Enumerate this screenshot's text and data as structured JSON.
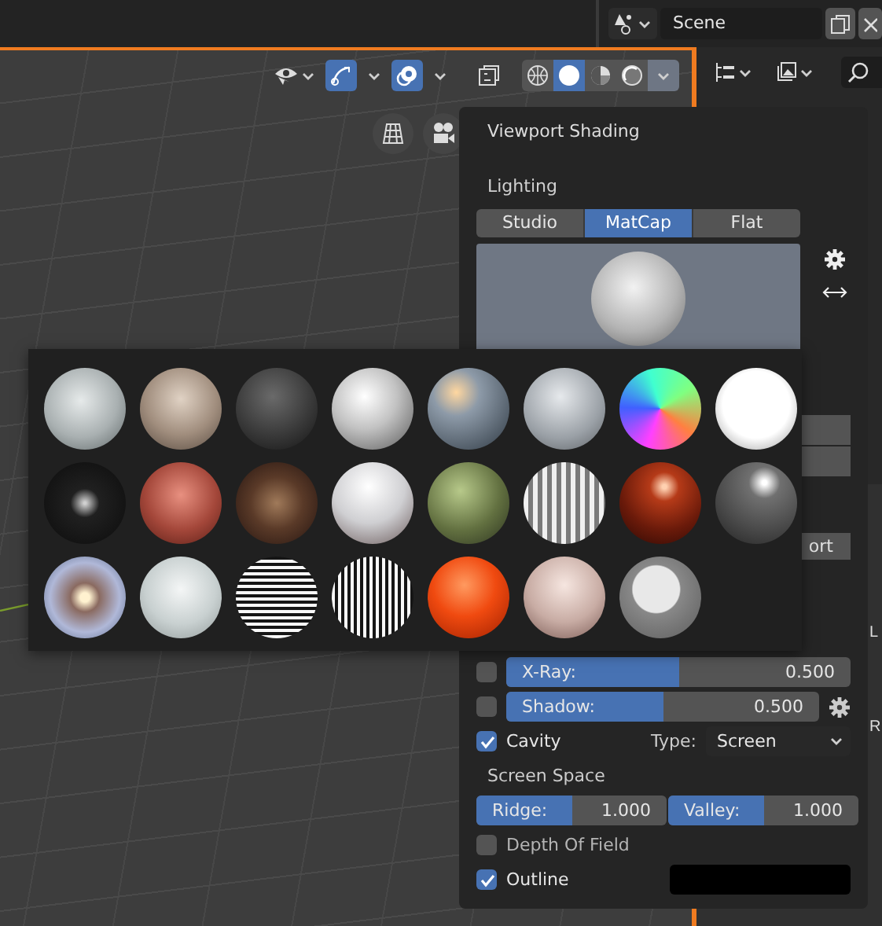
{
  "top_bar": {
    "scene": "Scene"
  },
  "viewport_header": {
    "gizmo_toggle": {
      "on": true
    },
    "overlay_toggle": {
      "on": true
    },
    "xray_toggle": {
      "on": false
    },
    "shading_modes": [
      {
        "kind": "wireframe",
        "selected": false
      },
      {
        "kind": "solid",
        "selected": true
      },
      {
        "kind": "material",
        "selected": false
      },
      {
        "kind": "rendered",
        "selected": false
      }
    ]
  },
  "properties": {
    "fields": [
      "L",
      "R"
    ]
  },
  "shading_panel": {
    "title": "Viewport Shading",
    "lighting_label": "Lighting",
    "lighting_tabs": [
      {
        "label": "Studio",
        "selected": false
      },
      {
        "label": "MatCap",
        "selected": true
      },
      {
        "label": "Flat",
        "selected": false
      }
    ],
    "background_fragment": "ort",
    "options": [
      {
        "kind": "slider",
        "label": "X-Ray:",
        "value": "0.500",
        "level": 0.5,
        "checked": false
      },
      {
        "kind": "slider_settings",
        "label": "Shadow:",
        "value": "0.500",
        "level": 0.5,
        "checked": false
      },
      {
        "kind": "check_select",
        "label": "Cavity",
        "checked": true,
        "select_label": "Type:",
        "select_value": "Screen"
      },
      {
        "kind": "heading",
        "label": "Screen Space"
      },
      {
        "kind": "slider_pair",
        "sliders": [
          {
            "label": "Ridge:",
            "value": "1.000",
            "level": 0.5
          },
          {
            "label": "Valley:",
            "value": "1.000",
            "level": 0.5
          }
        ]
      },
      {
        "kind": "check",
        "label": "Depth Of Field",
        "checked": false
      },
      {
        "kind": "check_color",
        "label": "Outline",
        "checked": true,
        "color": "#000000"
      }
    ]
  },
  "matcap_picker": {
    "items": [
      {
        "selected": false
      },
      {
        "selected": false
      },
      {
        "selected": false
      },
      {
        "selected": false
      },
      {
        "selected": false
      },
      {
        "selected": false
      },
      {
        "selected": false
      },
      {
        "selected": false
      },
      {
        "selected": false
      },
      {
        "selected": false
      },
      {
        "selected": false
      },
      {
        "selected": false
      },
      {
        "selected": false
      },
      {
        "selected": false
      },
      {
        "selected": false
      },
      {
        "selected": false
      },
      {
        "selected": false
      },
      {
        "selected": false
      },
      {
        "selected": false
      },
      {
        "selected": false
      },
      {
        "selected": false
      },
      {
        "selected": false
      },
      {
        "selected": false
      }
    ]
  }
}
